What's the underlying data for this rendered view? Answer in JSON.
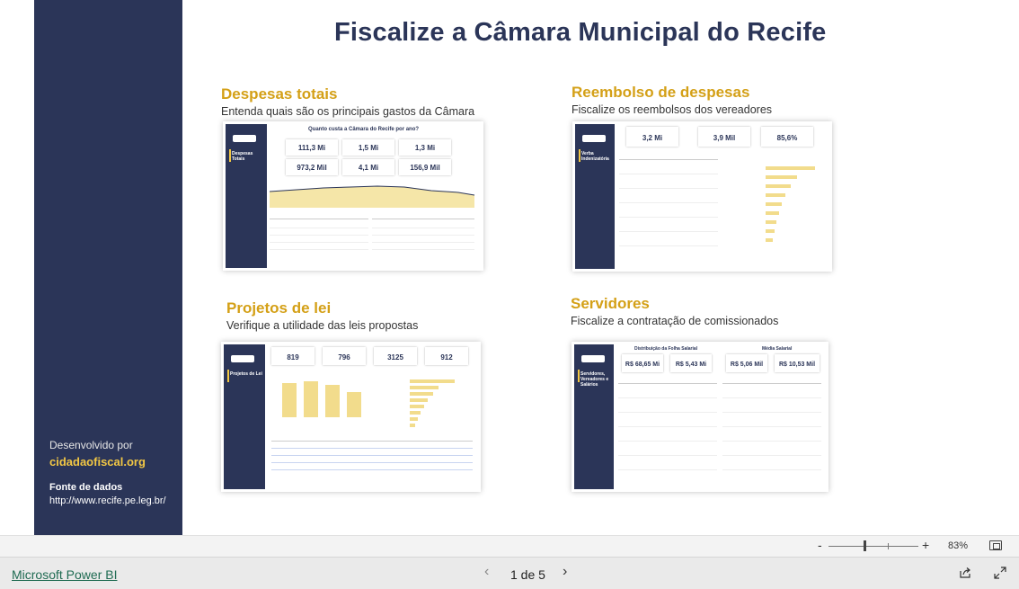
{
  "report": {
    "title": "Fiscalize a Câmara Municipal do Recife"
  },
  "sidebar": {
    "developed_by_label": "Desenvolvido por",
    "developed_by_link": "cidadaofiscal.org",
    "data_source_label": "Fonte de dados",
    "data_source_url": "http://www.recife.pe.leg.br/"
  },
  "cards": [
    {
      "heading": "Despesas totais",
      "subheading": "Entenda quais são os principais gastos da Câmara",
      "preview_title": "Quanto custa a Câmara do Recife por ano?",
      "preview_nav_title": "Despesas Totais",
      "kpis": [
        "111,3 Mi",
        "1,5 Mi",
        "1,3 Mi",
        "973,2 Mil",
        "4,1 Mi",
        "156,9 Mil"
      ]
    },
    {
      "heading": "Reembolso de despesas",
      "subheading": "Fiscalize os reembolsos dos vereadores",
      "preview_nav_title": "Verba Indenizatória",
      "kpis": [
        "3,2 Mi",
        "3,9 Mil",
        "85,6%"
      ]
    },
    {
      "heading": "Projetos de lei",
      "subheading": "Verifique a utilidade das leis propostas",
      "preview_nav_title": "Projetos de Lei",
      "kpis": [
        "819",
        "796",
        "3125",
        "912"
      ]
    },
    {
      "heading": "Servidores",
      "subheading": "Fiscalize a contratação de comissionados",
      "preview_title": "Distribuição da Folha Salarial",
      "preview_title_2": "Média Salarial",
      "preview_nav_title": "Servidores, Vereadores e Salários",
      "kpis": [
        "R$ 68,65 Mi",
        "R$ 5,43 Mi",
        "R$ 5,06 Mil",
        "R$ 10,53 Mil"
      ]
    }
  ],
  "viewer": {
    "zoom_minus": "-",
    "zoom_plus": "+",
    "zoom_level": "83%",
    "brand_link": "Microsoft Power BI",
    "prev": "‹",
    "next": "›",
    "page_indicator": "1 de 5"
  },
  "colors": {
    "navy": "#2b3558",
    "gold": "#d4a017",
    "link_yellow": "#f2c744"
  }
}
